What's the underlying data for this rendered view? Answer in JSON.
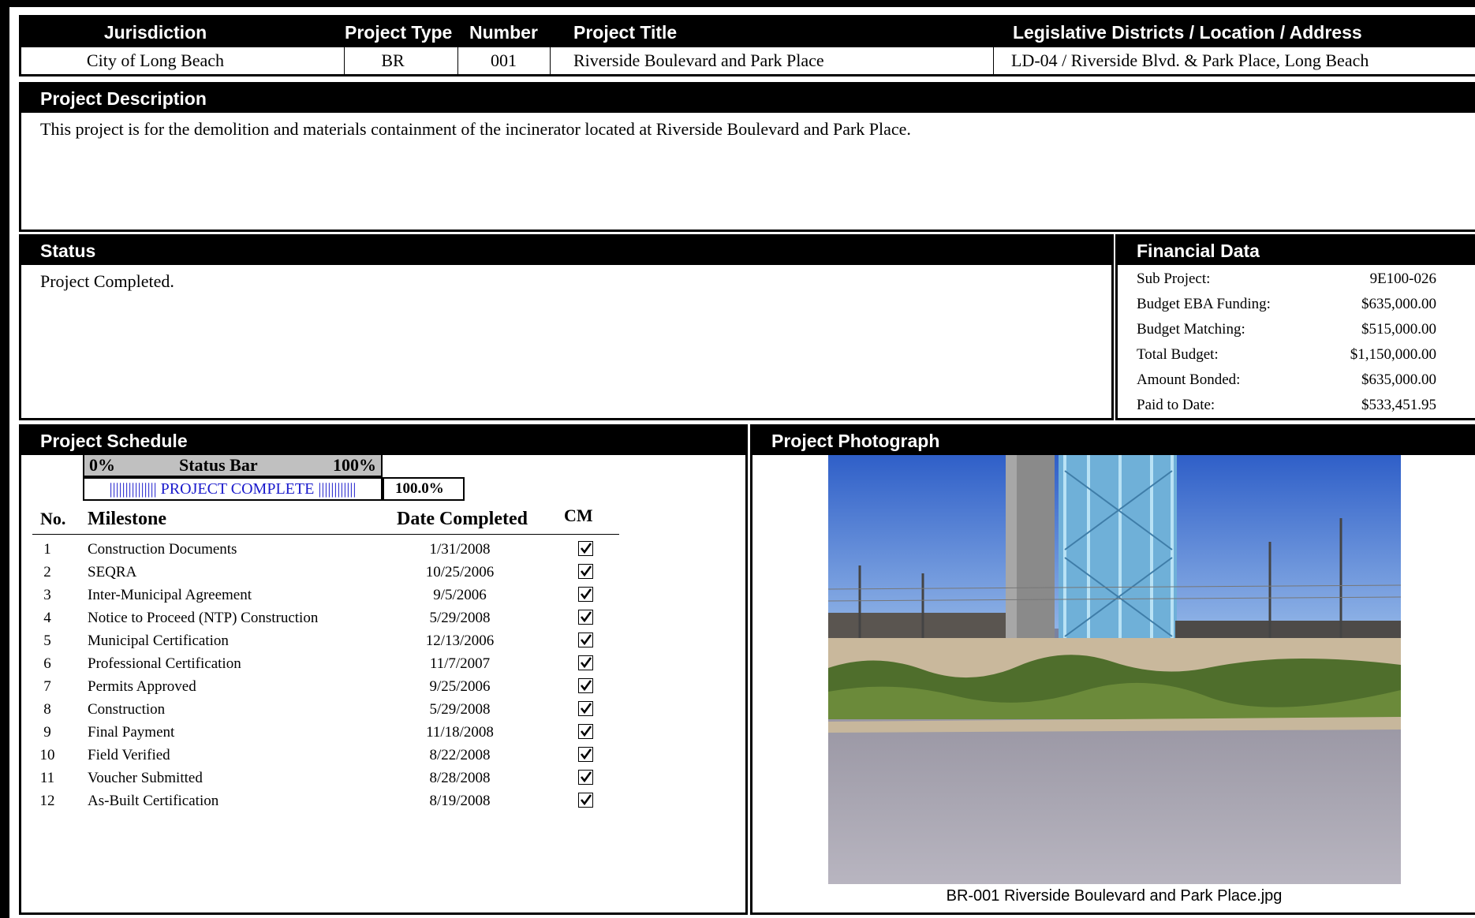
{
  "top_header": {
    "columns": [
      "Jurisdiction",
      "Project Type",
      "Number",
      "Project Title",
      "Legislative Districts / Location / Address"
    ],
    "values": [
      "City of Long Beach",
      "BR",
      "001",
      "Riverside Boulevard and Park Place",
      "LD-04 / Riverside Blvd. & Park Place, Long Beach"
    ]
  },
  "description": {
    "title": "Project Description",
    "text": "This project is for the demolition and materials containment of the incinerator located at Riverside Boulevard and Park Place."
  },
  "status": {
    "title": "Status",
    "text": "Project Completed."
  },
  "financial": {
    "title": "Financial Data",
    "rows": [
      {
        "label": "Sub Project:",
        "value": "9E100-026"
      },
      {
        "label": "Budget EBA Funding:",
        "value": "$635,000.00"
      },
      {
        "label": "Budget Matching:",
        "value": "$515,000.00"
      },
      {
        "label": "Total Budget:",
        "value": "$1,150,000.00"
      },
      {
        "label": "Amount Bonded:",
        "value": "$635,000.00"
      },
      {
        "label": "Paid to Date:",
        "value": "$533,451.95"
      }
    ]
  },
  "schedule": {
    "title": "Project Schedule",
    "status_bar": {
      "left": "0%",
      "label": "Status Bar",
      "right": "100%",
      "fill_text": "||||||||||||||| PROJECT COMPLETE ||||||||||||",
      "progress": 1.0,
      "percent_text": "100.0%"
    },
    "headers": {
      "no": "No.",
      "milestone": "Milestone",
      "date": "Date Completed",
      "cm": "CM"
    },
    "milestones": [
      {
        "no": "1",
        "name": "Construction Documents",
        "date": "1/31/2008",
        "cm": true
      },
      {
        "no": "2",
        "name": "SEQRA",
        "date": "10/25/2006",
        "cm": true
      },
      {
        "no": "3",
        "name": "Inter-Municipal Agreement",
        "date": "9/5/2006",
        "cm": true
      },
      {
        "no": "4",
        "name": "Notice to Proceed (NTP) Construction",
        "date": "5/29/2008",
        "cm": true
      },
      {
        "no": "5",
        "name": "Municipal Certification",
        "date": "12/13/2006",
        "cm": true
      },
      {
        "no": "6",
        "name": "Professional Certification",
        "date": "11/7/2007",
        "cm": true
      },
      {
        "no": "7",
        "name": "Permits Approved",
        "date": "9/25/2006",
        "cm": true
      },
      {
        "no": "8",
        "name": "Construction",
        "date": "5/29/2008",
        "cm": true
      },
      {
        "no": "9",
        "name": "Final Payment",
        "date": "11/18/2008",
        "cm": true
      },
      {
        "no": "10",
        "name": "Field Verified",
        "date": "8/22/2008",
        "cm": true
      },
      {
        "no": "11",
        "name": "Voucher Submitted",
        "date": "8/28/2008",
        "cm": true
      },
      {
        "no": "12",
        "name": "As-Built Certification",
        "date": "8/19/2008",
        "cm": true
      }
    ]
  },
  "photograph": {
    "title": "Project Photograph",
    "caption": "BR-001 Riverside Boulevard and Park Place.jpg"
  }
}
